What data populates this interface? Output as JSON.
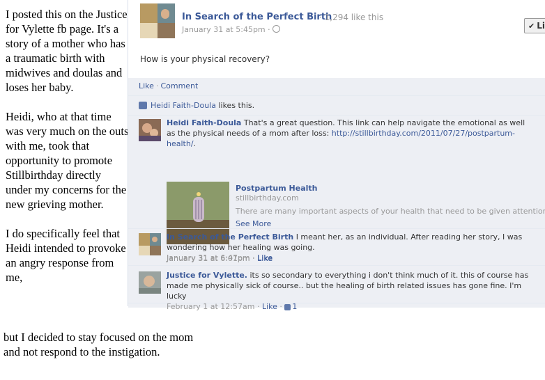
{
  "note": {
    "paragraph1": "I posted this on the Justice for Vylette fb page. It's a story of a mother who has a traumatic birth with midwives and doulas and loses her baby.",
    "paragraph2": "Heidi, who at that time was very much on the outs with me, took that opportunity to promote Stillbirthday directly under my concerns for the new grieving mother.",
    "paragraph3": "I do specifically feel that Heidi intended to provoke an angry response from me,",
    "paragraph4": "but I decided to stay focused on the mom and not respond to the instigation."
  },
  "post": {
    "page_name": "In Search of the Perfect Birth",
    "like_count": "· 1,294 like this",
    "timestamp": "January 31 at 5:45pm ·",
    "liked_button": "Liked",
    "body": "How is your physical recovery?",
    "actions": {
      "like": "Like",
      "comment": "Comment"
    },
    "likes_line": {
      "who": "Heidi Faith-Doula",
      "rest": "likes this."
    }
  },
  "comments": [
    {
      "author": "Heidi Faith-Doula",
      "text": "That's a great question. This link can help navigate the emotional as well as the physical needs of a mom after loss:",
      "link": "http://stillbirthday.com/2011/07/27/postpartum-health/",
      "link_suffix": ".",
      "time": "January 31 at 6:01pm",
      "like": "Like",
      "attachment": {
        "title": "Postpartum Health",
        "domain": "stillbirthday.com",
        "description": "There are many important aspects of your health that need to be given attention ...",
        "see_more": "See More"
      }
    },
    {
      "author": "In Search of the Perfect Birth",
      "text": "I meant her, as an individual. After reading her story, I was wondering how her healing was going.",
      "time": "January 31 at 6:47pm",
      "like": "Like"
    },
    {
      "author": "Justice for Vylette.",
      "text": "its so secondary to everything i don't think much of it. this of course has made me physically sick of course.. but the healing of birth related issues has gone fine. I'm lucky",
      "time": "February 1 at 12:57am",
      "like": "Like",
      "like_count": "1"
    }
  ],
  "colors": {
    "link": "#3b5998",
    "feedback_bg": "#edeff4",
    "meta": "#999999"
  }
}
